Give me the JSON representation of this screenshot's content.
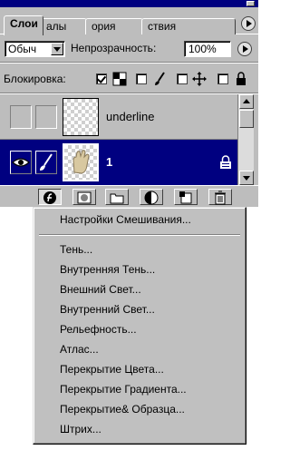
{
  "tabs": [
    "Слои",
    "алы",
    "ория",
    "ствия"
  ],
  "options": {
    "blend_mode": "Обыч",
    "opacity_label": "Непрозрачность:",
    "opacity_value": "100%"
  },
  "lock": {
    "label": "Блокировка:"
  },
  "layers": [
    {
      "name": "underline",
      "visible": false,
      "selected": false
    },
    {
      "name": "1",
      "visible": true,
      "selected": true
    }
  ],
  "bottom_icons": [
    "layer-style-icon",
    "mask-icon",
    "folder-icon",
    "adjustment-icon",
    "new-layer-icon",
    "trash-icon"
  ],
  "menu": {
    "top_item": "Настройки Смешивания...",
    "items": [
      "Тень...",
      "Внутренняя Тень...",
      "Внешний Свет...",
      "Внутренний Свет...",
      "Рельефность...",
      "Атлас...",
      "Перекрытие Цвета...",
      "Перекрытие Градиента...",
      "Перекрытие& Образца...",
      "Штрих..."
    ]
  },
  "colors": {
    "selection": "#000080",
    "panel": "#bdbdbd",
    "menu": "#c0c0c0"
  }
}
